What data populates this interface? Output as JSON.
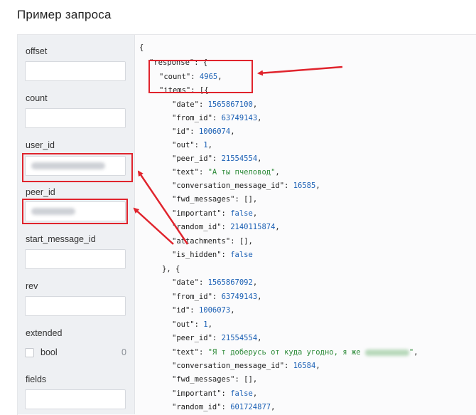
{
  "page": {
    "title": "Пример запроса"
  },
  "params": [
    {
      "label": "offset",
      "value": ""
    },
    {
      "label": "count",
      "value": ""
    },
    {
      "label": "user_id",
      "value": "",
      "blurred": true
    },
    {
      "label": "peer_id",
      "value": "",
      "blurred": true
    },
    {
      "label": "start_message_id",
      "value": ""
    },
    {
      "label": "rev",
      "value": ""
    },
    {
      "label": "extended"
    },
    {
      "label": "fields",
      "value": ""
    }
  ],
  "extended": {
    "checkbox_label": "bool",
    "count": "0"
  },
  "response": {
    "count": "4965",
    "items": [
      {
        "date": "1565867100",
        "from_id": "63749143",
        "id": "1006074",
        "out": "1",
        "peer_id": "21554554",
        "text": "\"А ты пчеловод\"",
        "conversation_message_id": "16585",
        "fwd_messages": "[]",
        "important": "false",
        "random_id": "2140115874",
        "attachments": "[]",
        "is_hidden": "false"
      },
      {
        "date": "1565867092",
        "from_id": "63749143",
        "id": "1006073",
        "out": "1",
        "peer_id": "21554554",
        "text_prefix": "\"Я т доберусь от куда угодно, я же ",
        "text_suffix": "\"",
        "conversation_message_id": "16584",
        "fwd_messages": "[]",
        "important": "false",
        "random_id": "601724877"
      }
    ]
  },
  "keys": {
    "response": "\"response\"",
    "count": "\"count\"",
    "items": "\"items\"",
    "date": "\"date\"",
    "from_id": "\"from_id\"",
    "id": "\"id\"",
    "out": "\"out\"",
    "peer_id": "\"peer_id\"",
    "text": "\"text\"",
    "conversation_message_id": "\"conversation_message_id\"",
    "fwd_messages": "\"fwd_messages\"",
    "important": "\"important\"",
    "random_id": "\"random_id\"",
    "attachments": "\"attachments\"",
    "is_hidden": "\"is_hidden\""
  },
  "colors": {
    "highlight": "#e0242d",
    "number": "#1a5fb4",
    "string": "#2e8b3a",
    "sidebar_bg": "#eef0f3"
  }
}
